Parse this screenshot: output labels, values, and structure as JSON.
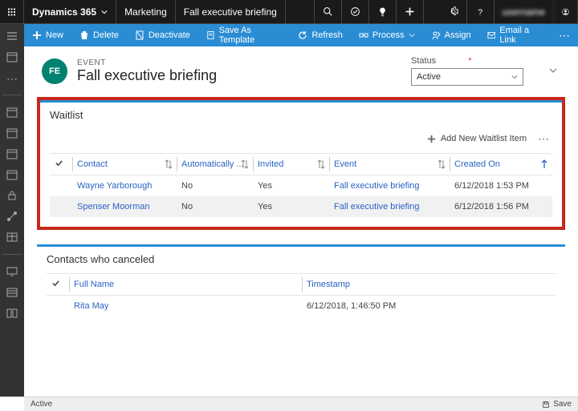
{
  "top": {
    "product": "Dynamics 365",
    "area": "Marketing",
    "crumb": "Fall executive briefing",
    "user": "username"
  },
  "cmd": {
    "new": "New",
    "delete": "Delete",
    "deactivate": "Deactivate",
    "save_as_template": "Save As Template",
    "refresh": "Refresh",
    "process": "Process",
    "assign": "Assign",
    "email_link": "Email a Link"
  },
  "record": {
    "eyebrow": "EVENT",
    "avatar": "FE",
    "title": "Fall executive briefing",
    "status_label": "Status",
    "status_value": "Active"
  },
  "waitlist": {
    "title": "Waitlist",
    "add_label": "Add New Waitlist Item",
    "cols": {
      "contact": "Contact",
      "auto": "Automatically ...",
      "invited": "Invited",
      "event": "Event",
      "created": "Created On"
    },
    "rows": [
      {
        "contact": "Wayne Yarborough",
        "auto": "No",
        "invited": "Yes",
        "event": "Fall executive briefing",
        "created": "6/12/2018 1:53 PM"
      },
      {
        "contact": "Spenser Moorman",
        "auto": "No",
        "invited": "Yes",
        "event": "Fall executive briefing",
        "created": "6/12/2018 1:56 PM"
      }
    ]
  },
  "canceled": {
    "title": "Contacts who canceled",
    "cols": {
      "full_name": "Full Name",
      "timestamp": "Timestamp"
    },
    "rows": [
      {
        "full_name": "Rita May",
        "timestamp": "6/12/2018, 1:46:50 PM"
      }
    ]
  },
  "footer": {
    "status": "Active",
    "save": "Save"
  }
}
